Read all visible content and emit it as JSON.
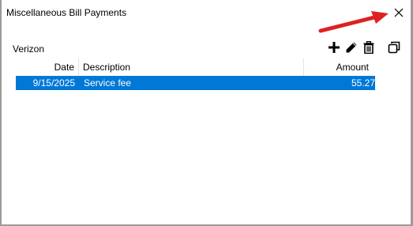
{
  "window": {
    "title": "Miscellaneous Bill Payments"
  },
  "account": {
    "name": "Verizon"
  },
  "toolbar": {
    "icons": [
      "plus-icon",
      "pencil-icon",
      "trash-icon",
      "copy-icon"
    ]
  },
  "grid": {
    "columns": [
      "Date",
      "Description",
      "Amount"
    ],
    "rows": [
      {
        "date": "9/15/2025",
        "description": "Service fee",
        "amount": "55.27"
      }
    ]
  },
  "colors": {
    "selection": "#0078d7",
    "annotation_arrow": "#e02020"
  }
}
